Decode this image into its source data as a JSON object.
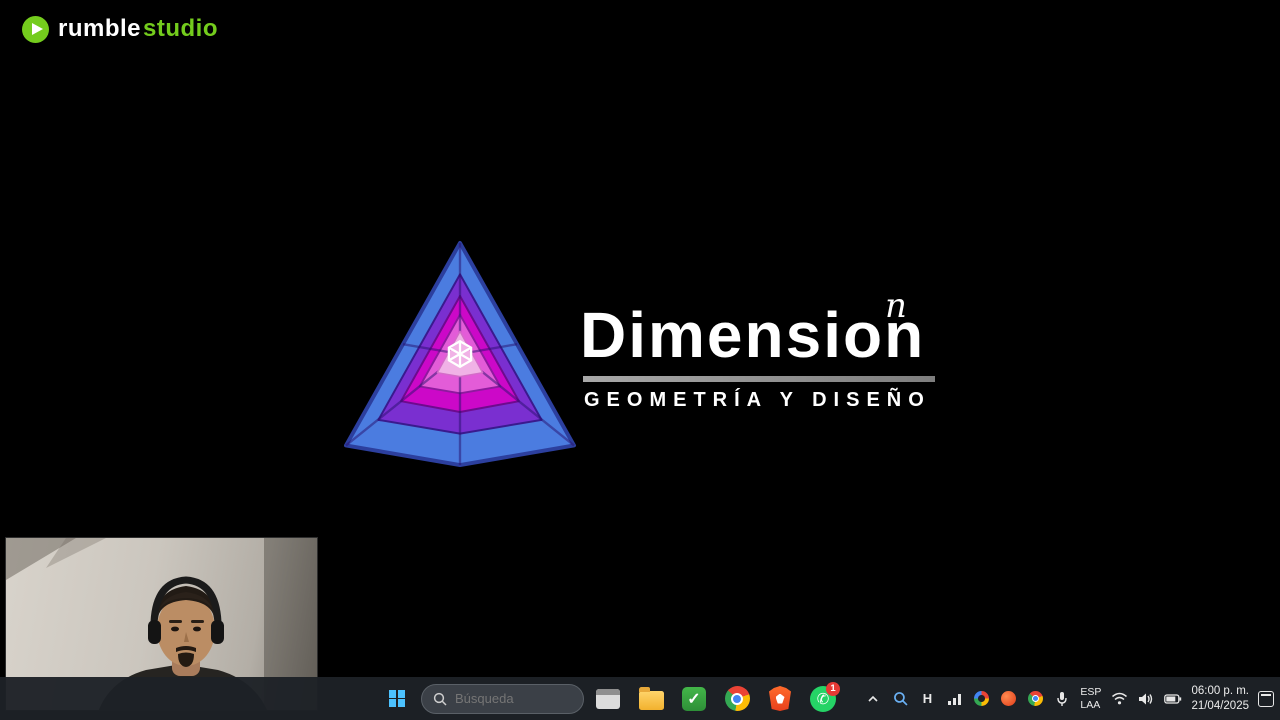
{
  "brand": {
    "name": "rumble",
    "suffix": "studio"
  },
  "logo": {
    "title": "Dimensio",
    "title_last": "n",
    "exponent": "n",
    "subtitle": "GEOMETRÍA Y DISEÑO",
    "colors": {
      "outer_blue": "#4b7ce0",
      "ring_purple": "#7a2fd0",
      "ring_magenta": "#cc08c8",
      "ring_pink": "#e35cd8",
      "center_pale": "#f0b2e6"
    }
  },
  "taskbar": {
    "search_placeholder": "Búsqueda",
    "checkmark": "✓",
    "whatsapp_badge": "1",
    "tray": {
      "h_label": "H",
      "lang_top": "ESP",
      "lang_bottom": "LAA",
      "time": "06:00 p. m.",
      "date": "21/04/2025"
    }
  }
}
